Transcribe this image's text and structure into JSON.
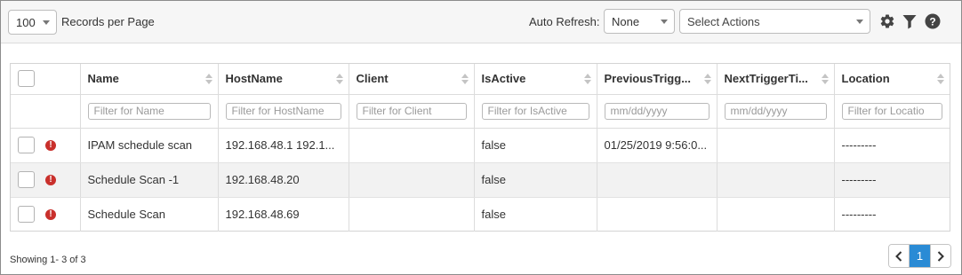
{
  "toolbar": {
    "page_size_value": "100",
    "records_per_page_label": "Records per Page",
    "auto_refresh_label": "Auto Refresh:",
    "auto_refresh_value": "None",
    "actions_placeholder": "Select Actions",
    "icons": [
      "gear-icon",
      "filter-icon",
      "help-icon"
    ]
  },
  "table": {
    "columns": [
      "Name",
      "HostName",
      "Client",
      "IsActive",
      "PreviousTrigg...",
      "NextTriggerTi...",
      "Location"
    ],
    "filters": [
      "Filter for Name",
      "Filter for HostName",
      "Filter for Client",
      "Filter for IsActive",
      "mm/dd/yyyy",
      "mm/dd/yyyy",
      "Filter for Locatio"
    ],
    "rows": [
      {
        "name": "IPAM schedule scan",
        "hostname": "192.168.48.1 192.1...",
        "client": "",
        "isactive": "false",
        "previous": "01/25/2019 9:56:0...",
        "next": "",
        "location": "---------"
      },
      {
        "name": "Schedule Scan -1",
        "hostname": "192.168.48.20",
        "client": "",
        "isactive": "false",
        "previous": "",
        "next": "",
        "location": "---------"
      },
      {
        "name": "Schedule Scan",
        "hostname": "192.168.48.69",
        "client": "",
        "isactive": "false",
        "previous": "",
        "next": "",
        "location": "---------"
      }
    ],
    "status_icon": "warning-icon",
    "status_glyph": "!"
  },
  "footer": {
    "showing_text": "Showing 1- 3 of 3",
    "current_page": "1"
  },
  "colors": {
    "accent": "#2a8bd5",
    "warning": "#c9302c",
    "alt_row": "#f2f2f2"
  }
}
